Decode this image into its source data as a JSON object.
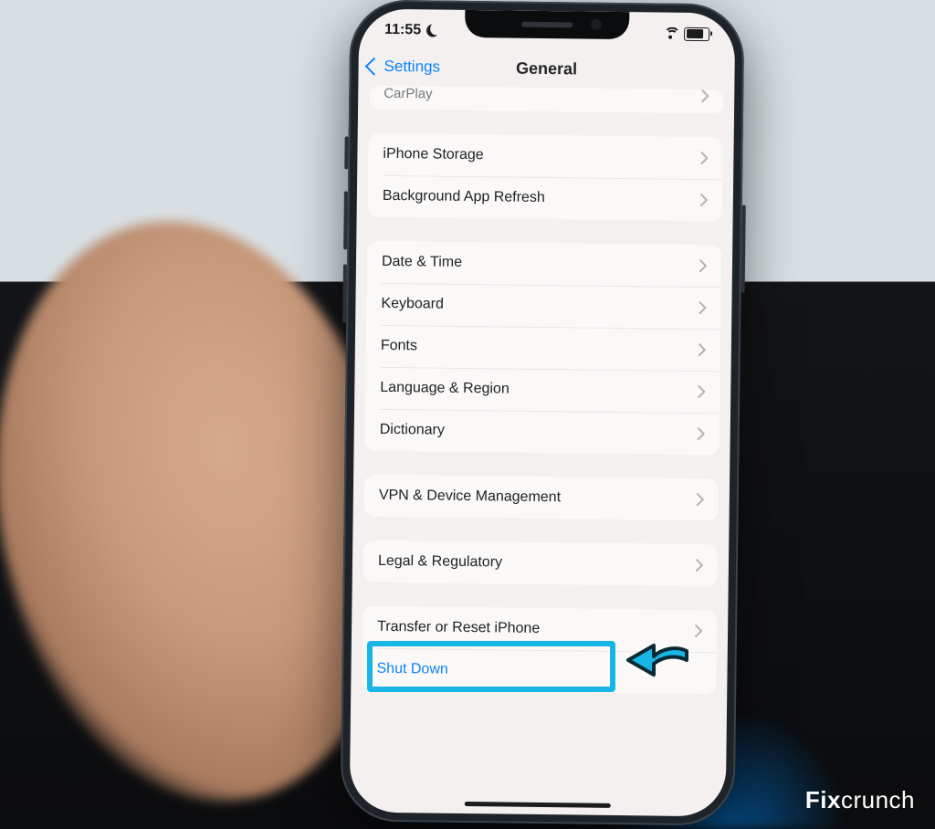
{
  "status": {
    "time": "11:55"
  },
  "nav": {
    "back_label": "Settings",
    "title": "General"
  },
  "rows": {
    "carplay": "CarPlay",
    "storage": "iPhone Storage",
    "bg_refresh": "Background App Refresh",
    "date_time": "Date & Time",
    "keyboard": "Keyboard",
    "fonts": "Fonts",
    "lang_region": "Language & Region",
    "dictionary": "Dictionary",
    "vpn": "VPN & Device Management",
    "legal": "Legal & Regulatory",
    "transfer_reset": "Transfer or Reset iPhone",
    "shutdown": "Shut Down"
  },
  "watermark": {
    "bold": "Fix",
    "rest": "crunch"
  },
  "colors": {
    "link": "#0a84ff",
    "highlight": "#18b6e6"
  }
}
